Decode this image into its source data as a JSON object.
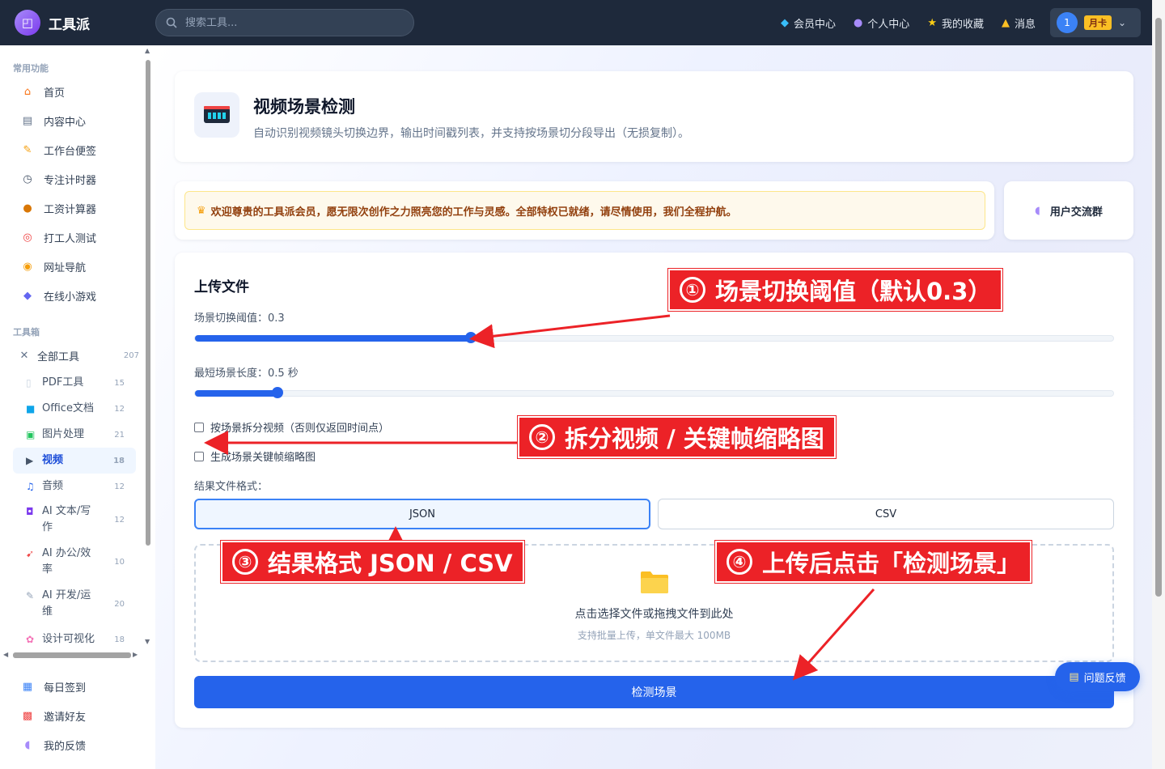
{
  "topbar": {
    "logo_text": "工具派",
    "search_placeholder": "搜索工具...",
    "nav": [
      {
        "icon": "gem-icon",
        "label": "会员中心"
      },
      {
        "icon": "user-icon",
        "label": "个人中心"
      },
      {
        "icon": "star-icon",
        "label": "我的收藏"
      },
      {
        "icon": "bell-icon",
        "label": "消息"
      }
    ],
    "user": {
      "avatar": "1",
      "badge": "月卡"
    }
  },
  "sidebar": {
    "common_title": "常用功能",
    "common": [
      {
        "icon": "home-icon",
        "label": "首页"
      },
      {
        "icon": "content-icon",
        "label": "内容中心"
      },
      {
        "icon": "note-icon",
        "label": "工作台便签"
      },
      {
        "icon": "timer-icon",
        "label": "专注计时器"
      },
      {
        "icon": "money-icon",
        "label": "工资计算器"
      },
      {
        "icon": "target-icon",
        "label": "打工人测试"
      },
      {
        "icon": "compass-icon",
        "label": "网址导航"
      },
      {
        "icon": "gamepad-icon",
        "label": "在线小游戏"
      }
    ],
    "tools_title": "工具箱",
    "all_tools": {
      "icon": "tools-icon",
      "label": "全部工具",
      "count": "207"
    },
    "tools": [
      {
        "icon": "pdf-icon",
        "label": "PDF工具",
        "count": "15"
      },
      {
        "icon": "office-icon",
        "label": "Office文档",
        "count": "12"
      },
      {
        "icon": "image-icon",
        "label": "图片处理",
        "count": "21"
      },
      {
        "icon": "video-icon",
        "label": "视频",
        "count": "18"
      },
      {
        "icon": "music-icon",
        "label": "音频",
        "count": "12"
      },
      {
        "icon": "robot-icon",
        "label": "AI 文本/写作",
        "count": "12"
      },
      {
        "icon": "rocket-icon",
        "label": "AI 办公/效率",
        "count": "10"
      },
      {
        "icon": "wrench-icon",
        "label": "AI 开发/运维",
        "count": "20"
      },
      {
        "icon": "palette-icon",
        "label": "设计可视化",
        "count": "18"
      }
    ],
    "bottom": [
      {
        "icon": "calendar-icon",
        "label": "每日签到"
      },
      {
        "icon": "gift-icon",
        "label": "邀请好友"
      },
      {
        "icon": "speech-icon",
        "label": "我的反馈"
      }
    ]
  },
  "header": {
    "title": "视频场景检测",
    "desc": "自动识别视频镜头切换边界，输出时间戳列表，并支持按场景切分段导出（无损复制）。"
  },
  "banner": {
    "icon": "crown-icon",
    "text": "欢迎尊贵的工具派会员，愿无限次创作之力照亮您的工作与灵感。全部特权已就绪，请尽情使用，我们全程护航。",
    "community_label": "用户交流群"
  },
  "upload": {
    "section_title": "上传文件",
    "threshold_label": "场景切换阈值：0.3",
    "threshold_value": 0.3,
    "min_length_label": "最短场景长度：0.5 秒",
    "min_length_fraction": 0.09,
    "split_checkbox": "按场景拆分视频（否则仅返回时间点）",
    "keyframe_checkbox": "生成场景关键帧缩略图",
    "format_label": "结果文件格式：",
    "formats": [
      "JSON",
      "CSV"
    ],
    "selected_format": "JSON",
    "drop_text": "点击选择文件或拖拽文件到此处",
    "drop_hint": "支持批量上传，单文件最大 100MB",
    "submit_label": "检测场景"
  },
  "feedback_label": "问题反馈",
  "annotations": [
    {
      "num": "①",
      "text": "场景切换阈值（默认0.3）"
    },
    {
      "num": "②",
      "text": "拆分视频 / 关键帧缩略图"
    },
    {
      "num": "③",
      "text": "结果格式 JSON / CSV"
    },
    {
      "num": "④",
      "text": "上传后点击「检测场景」"
    }
  ],
  "colors": {
    "accent": "#2563eb",
    "topbar": "#1e293b",
    "annotation": "#ec2227",
    "banner_text": "#92400e"
  }
}
